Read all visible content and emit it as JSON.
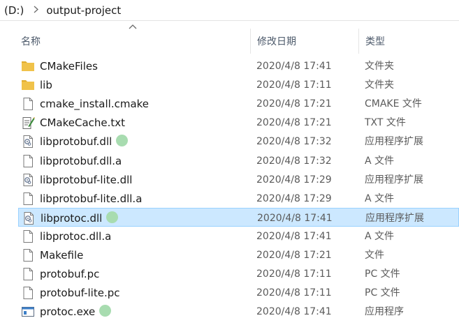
{
  "breadcrumb": {
    "drive": "(D:)",
    "folder": "output-project"
  },
  "columns": {
    "name": "名称",
    "date": "修改日期",
    "type": "类型"
  },
  "files": [
    {
      "name": "CMakeFiles",
      "date": "2020/4/8 17:41",
      "type": "文件夹",
      "icon": "folder-icon",
      "marked": false,
      "selected": false
    },
    {
      "name": "lib",
      "date": "2020/4/8 17:11",
      "type": "文件夹",
      "icon": "folder-icon",
      "marked": false,
      "selected": false
    },
    {
      "name": "cmake_install.cmake",
      "date": "2020/4/8 17:21",
      "type": "CMAKE 文件",
      "icon": "file-icon",
      "marked": false,
      "selected": false
    },
    {
      "name": "CMakeCache.txt",
      "date": "2020/4/8 17:21",
      "type": "TXT 文件",
      "icon": "text-file-icon",
      "marked": false,
      "selected": false
    },
    {
      "name": "libprotobuf.dll",
      "date": "2020/4/8 17:32",
      "type": "应用程序扩展",
      "icon": "dll-file-icon",
      "marked": true,
      "selected": false
    },
    {
      "name": "libprotobuf.dll.a",
      "date": "2020/4/8 17:32",
      "type": "A 文件",
      "icon": "file-icon",
      "marked": false,
      "selected": false
    },
    {
      "name": "libprotobuf-lite.dll",
      "date": "2020/4/8 17:29",
      "type": "应用程序扩展",
      "icon": "dll-file-icon",
      "marked": false,
      "selected": false
    },
    {
      "name": "libprotobuf-lite.dll.a",
      "date": "2020/4/8 17:29",
      "type": "A 文件",
      "icon": "file-icon",
      "marked": false,
      "selected": false
    },
    {
      "name": "libprotoc.dll",
      "date": "2020/4/8 17:41",
      "type": "应用程序扩展",
      "icon": "dll-file-icon",
      "marked": true,
      "selected": true
    },
    {
      "name": "libprotoc.dll.a",
      "date": "2020/4/8 17:41",
      "type": "A 文件",
      "icon": "file-icon",
      "marked": false,
      "selected": false
    },
    {
      "name": "Makefile",
      "date": "2020/4/8 17:21",
      "type": "文件",
      "icon": "file-icon",
      "marked": false,
      "selected": false
    },
    {
      "name": "protobuf.pc",
      "date": "2020/4/8 17:11",
      "type": "PC 文件",
      "icon": "file-icon",
      "marked": false,
      "selected": false
    },
    {
      "name": "protobuf-lite.pc",
      "date": "2020/4/8 17:11",
      "type": "PC 文件",
      "icon": "file-icon",
      "marked": false,
      "selected": false
    },
    {
      "name": "protoc.exe",
      "date": "2020/4/8 17:41",
      "type": "应用程序",
      "icon": "exe-file-icon",
      "marked": true,
      "selected": false
    }
  ],
  "colors": {
    "selection_bg": "#cce8ff",
    "selection_border": "#99d1ff",
    "marker_dot": "#a8dcb0",
    "folder": "#f0c24a"
  }
}
